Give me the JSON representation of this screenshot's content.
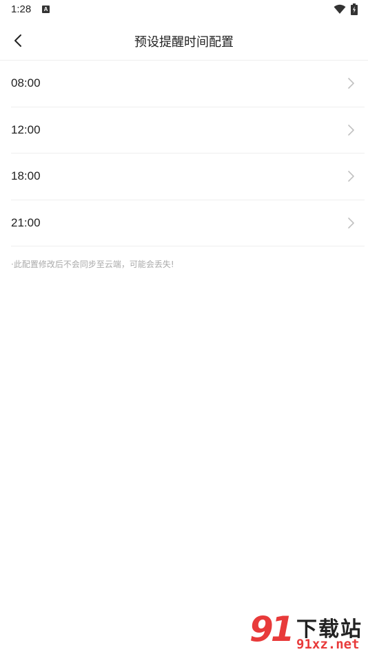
{
  "status_bar": {
    "time": "1:28",
    "notification_icon": "a-badge-icon",
    "notification_letter": "A",
    "wifi_icon": "wifi-icon",
    "battery_icon": "battery-charging-icon"
  },
  "header": {
    "back_icon": "chevron-left-icon",
    "title": "预设提醒时间配置"
  },
  "times": [
    {
      "label": "08:00"
    },
    {
      "label": "12:00"
    },
    {
      "label": "18:00"
    },
    {
      "label": "21:00"
    }
  ],
  "notice": "·此配置修改后不会同步至云端，可能会丢失!",
  "watermark": {
    "number": "91",
    "text": "下载站",
    "url": "91xz.net"
  },
  "colors": {
    "divider": "#eeeeee",
    "muted_text": "#aaaaaa",
    "chevron": "#c0c0c0",
    "watermark_red": "#e83a3a"
  }
}
